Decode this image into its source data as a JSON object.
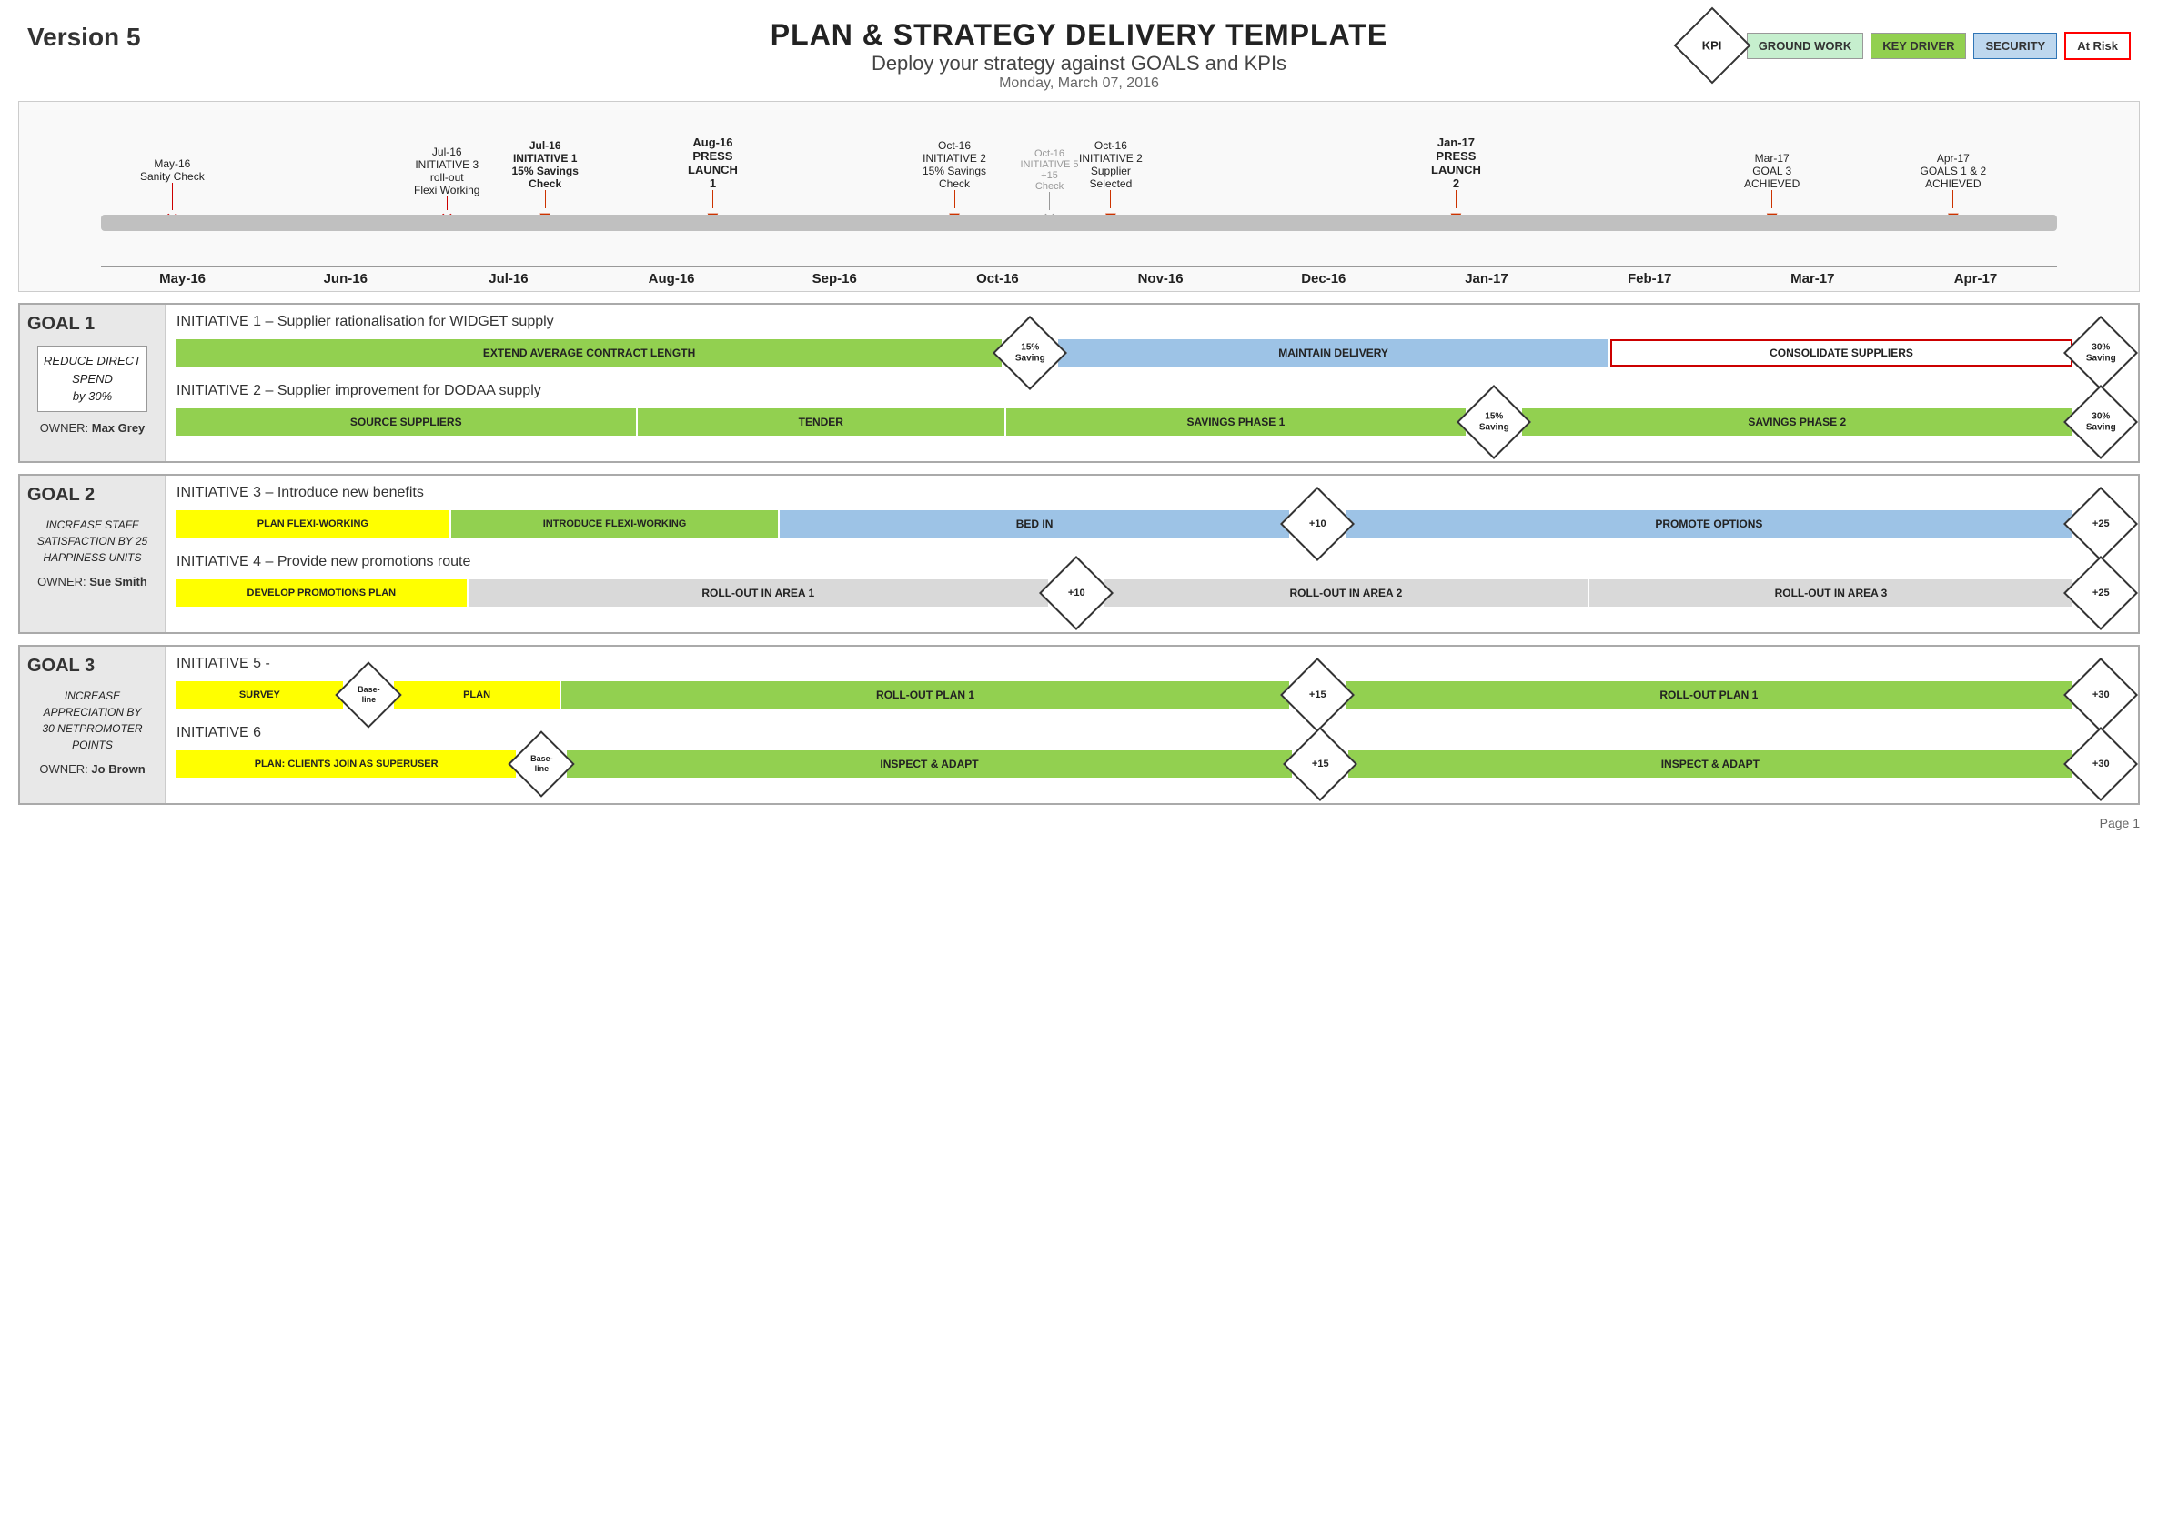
{
  "header": {
    "title": "PLAN & STRATEGY DELIVERY TEMPLATE",
    "subtitle": "Deploy your strategy against GOALS and KPIs",
    "date": "Monday, March 07, 2016",
    "version": "Version 5"
  },
  "legend": {
    "kpi": "KPI",
    "groundwork": "GROUND WORK",
    "keydriver": "KEY DRIVER",
    "security": "SECURITY",
    "atrisk": "At Risk"
  },
  "timeline": {
    "months": [
      "May-16",
      "Jun-16",
      "Jul-16",
      "Aug-16",
      "Sep-16",
      "Oct-16",
      "Nov-16",
      "Dec-16",
      "Jan-17",
      "Feb-17",
      "Mar-17",
      "Apr-17"
    ],
    "events": [
      {
        "label": "May-16\nSanity Check",
        "col": 0.2,
        "type": "x",
        "bold": false
      },
      {
        "label": "Jul-16\nINITIATIVE 3\nroll-out\nFlexi Working",
        "col": 1.8,
        "type": "x",
        "bold": false
      },
      {
        "label": "Jul-16\nINITIATIVE 1\n15% Savings\nCheck",
        "col": 2.2,
        "type": "down",
        "bold": true
      },
      {
        "label": "Aug-16\nPRESS\nLAUNCH\n1",
        "col": 3.3,
        "type": "down",
        "bold": true
      },
      {
        "label": "Oct-16\nINITIATIVE 2\n15% Savings\nCheck",
        "col": 5.0,
        "type": "down",
        "bold": false
      },
      {
        "label": "Oct-16 5\nINITIATIVE 5\n+15\nCheck",
        "col": 5.5,
        "type": "x",
        "bold": false,
        "gray": true
      },
      {
        "label": "Oct-16\nINITIATIVE 2\nSupplier\nSelected",
        "col": 5.8,
        "type": "down",
        "bold": false
      },
      {
        "label": "Jan-17\nPRESS\nLAUNCH\n2",
        "col": 8.3,
        "type": "down",
        "bold": true
      },
      {
        "label": "Mar-17\nGOAL 3\nACHIEVED",
        "col": 10.3,
        "type": "down",
        "bold": false
      },
      {
        "label": "Apr-17\nGOALS 1 & 2\nACHIEVED",
        "col": 11.3,
        "type": "down",
        "bold": false
      }
    ]
  },
  "goals": [
    {
      "id": "GOAL 1",
      "desc": "REDUCE DIRECT\nSPEND\nby 30%",
      "owner_label": "OWNER:",
      "owner": "Max Grey",
      "initiatives": [
        {
          "title": "INITIATIVE 1 – Supplier rationalisation for WIDGET supply",
          "bars": [
            {
              "label": "EXTEND AVERAGE CONTRACT LENGTH",
              "type": "green",
              "flex": 4.5
            },
            {
              "label": "15%\nSaving",
              "type": "diamond"
            },
            {
              "label": "MAINTAIN DELIVERY",
              "type": "blue",
              "flex": 3
            },
            {
              "label": "CONSOLIDATE SUPPLIERS",
              "type": "red-border",
              "flex": 2.5
            },
            {
              "label": "30%\nSaving",
              "type": "diamond"
            }
          ]
        },
        {
          "title": "INITIATIVE 2 – Supplier improvement for DODAA supply",
          "bars": [
            {
              "label": "SOURCE SUPPLIERS",
              "type": "green",
              "flex": 2.5
            },
            {
              "label": "TENDER",
              "type": "green",
              "flex": 2
            },
            {
              "label": "SAVINGS PHASE 1",
              "type": "green",
              "flex": 2.5
            },
            {
              "label": "15%\nSaving",
              "type": "diamond"
            },
            {
              "label": "SAVINGS PHASE 2",
              "type": "green",
              "flex": 3
            },
            {
              "label": "30%\nSaving",
              "type": "diamond"
            }
          ]
        }
      ]
    },
    {
      "id": "GOAL 2",
      "desc": "INCREASE STAFF\nSATISFACTION BY 25\nHAPPINESS UNITS",
      "owner_label": "OWNER:",
      "owner": "Sue Smith",
      "initiatives": [
        {
          "title": "INITIATIVE 3 – Introduce new benefits",
          "bars": [
            {
              "label": "PLAN FLEXI-WORKING",
              "type": "yellow",
              "flex": 1.5
            },
            {
              "label": "INTRODUCE FLEXI-WORKING",
              "type": "green",
              "flex": 1.8
            },
            {
              "label": "BED IN",
              "type": "blue",
              "flex": 2.8
            },
            {
              "label": "+10",
              "type": "diamond"
            },
            {
              "label": "PROMOTE OPTIONS",
              "type": "blue",
              "flex": 4
            },
            {
              "label": "+25",
              "type": "diamond"
            }
          ]
        },
        {
          "title": "INITIATIVE 4 – Provide new promotions route",
          "bars": [
            {
              "label": "DEVELOP PROMOTIONS PLAN",
              "type": "yellow",
              "flex": 1.5
            },
            {
              "label": "ROLL-OUT IN AREA 1",
              "type": "gray",
              "flex": 3
            },
            {
              "label": "+10",
              "type": "diamond"
            },
            {
              "label": "ROLL-OUT IN AREA 2",
              "type": "gray",
              "flex": 2.5
            },
            {
              "label": "ROLL-OUT IN AREA 3",
              "type": "gray",
              "flex": 2.5
            },
            {
              "label": "+25",
              "type": "diamond"
            }
          ]
        }
      ]
    },
    {
      "id": "GOAL 3",
      "desc": "INCREASE\nAPPRECIATION BY\n30 NETPROMOTER\nPOINTS",
      "owner_label": "OWNER:",
      "owner": "Jo Brown",
      "initiatives": [
        {
          "title": "INITIATIVE 5 -",
          "bars": [
            {
              "label": "SURVEY",
              "type": "yellow",
              "flex": 0.8
            },
            {
              "label": "Base-\nline",
              "type": "diamond-small"
            },
            {
              "label": "PLAN",
              "type": "yellow",
              "flex": 0.8
            },
            {
              "label": "ROLL-OUT PLAN 1",
              "type": "green",
              "flex": 3.5
            },
            {
              "label": "+15",
              "type": "diamond"
            },
            {
              "label": "ROLL-OUT PLAN 1",
              "type": "green",
              "flex": 3.5
            },
            {
              "label": "+30",
              "type": "diamond"
            }
          ]
        },
        {
          "title": "INITIATIVE 6",
          "bars": [
            {
              "label": "PLAN: CLIENTS JOIN AS SUPERUSER",
              "type": "yellow",
              "flex": 1.5
            },
            {
              "label": "Base-\nline",
              "type": "diamond-small"
            },
            {
              "label": "INSPECT & ADAPT",
              "type": "green",
              "flex": 3.2
            },
            {
              "label": "+15",
              "type": "diamond"
            },
            {
              "label": "INSPECT & ADAPT",
              "type": "green",
              "flex": 3.2
            },
            {
              "label": "+30",
              "type": "diamond"
            }
          ]
        }
      ]
    }
  ],
  "page_number": "Page 1"
}
